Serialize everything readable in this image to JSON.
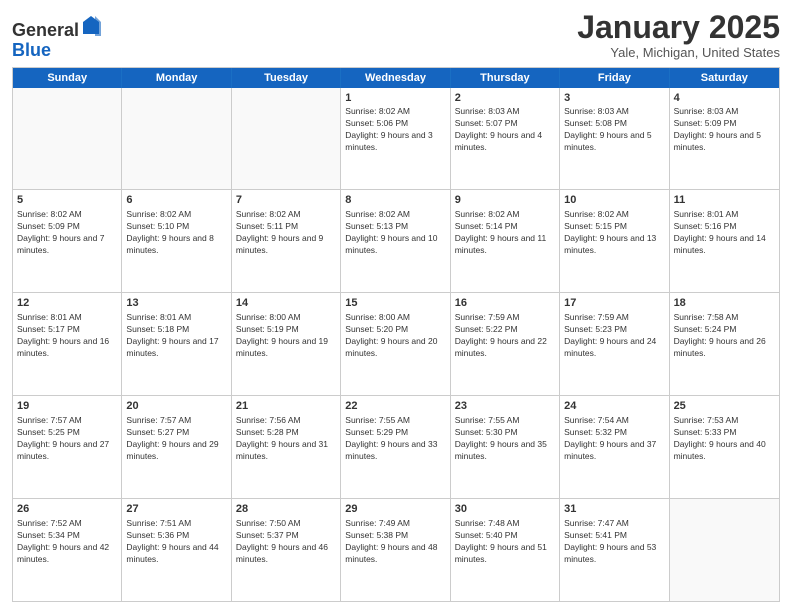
{
  "logo": {
    "general": "General",
    "blue": "Blue"
  },
  "title": "January 2025",
  "location": "Yale, Michigan, United States",
  "days_of_week": [
    "Sunday",
    "Monday",
    "Tuesday",
    "Wednesday",
    "Thursday",
    "Friday",
    "Saturday"
  ],
  "weeks": [
    [
      {
        "day": "",
        "info": ""
      },
      {
        "day": "",
        "info": ""
      },
      {
        "day": "",
        "info": ""
      },
      {
        "day": "1",
        "info": "Sunrise: 8:02 AM\nSunset: 5:06 PM\nDaylight: 9 hours and 3 minutes."
      },
      {
        "day": "2",
        "info": "Sunrise: 8:03 AM\nSunset: 5:07 PM\nDaylight: 9 hours and 4 minutes."
      },
      {
        "day": "3",
        "info": "Sunrise: 8:03 AM\nSunset: 5:08 PM\nDaylight: 9 hours and 5 minutes."
      },
      {
        "day": "4",
        "info": "Sunrise: 8:03 AM\nSunset: 5:09 PM\nDaylight: 9 hours and 5 minutes."
      }
    ],
    [
      {
        "day": "5",
        "info": "Sunrise: 8:02 AM\nSunset: 5:09 PM\nDaylight: 9 hours and 7 minutes."
      },
      {
        "day": "6",
        "info": "Sunrise: 8:02 AM\nSunset: 5:10 PM\nDaylight: 9 hours and 8 minutes."
      },
      {
        "day": "7",
        "info": "Sunrise: 8:02 AM\nSunset: 5:11 PM\nDaylight: 9 hours and 9 minutes."
      },
      {
        "day": "8",
        "info": "Sunrise: 8:02 AM\nSunset: 5:13 PM\nDaylight: 9 hours and 10 minutes."
      },
      {
        "day": "9",
        "info": "Sunrise: 8:02 AM\nSunset: 5:14 PM\nDaylight: 9 hours and 11 minutes."
      },
      {
        "day": "10",
        "info": "Sunrise: 8:02 AM\nSunset: 5:15 PM\nDaylight: 9 hours and 13 minutes."
      },
      {
        "day": "11",
        "info": "Sunrise: 8:01 AM\nSunset: 5:16 PM\nDaylight: 9 hours and 14 minutes."
      }
    ],
    [
      {
        "day": "12",
        "info": "Sunrise: 8:01 AM\nSunset: 5:17 PM\nDaylight: 9 hours and 16 minutes."
      },
      {
        "day": "13",
        "info": "Sunrise: 8:01 AM\nSunset: 5:18 PM\nDaylight: 9 hours and 17 minutes."
      },
      {
        "day": "14",
        "info": "Sunrise: 8:00 AM\nSunset: 5:19 PM\nDaylight: 9 hours and 19 minutes."
      },
      {
        "day": "15",
        "info": "Sunrise: 8:00 AM\nSunset: 5:20 PM\nDaylight: 9 hours and 20 minutes."
      },
      {
        "day": "16",
        "info": "Sunrise: 7:59 AM\nSunset: 5:22 PM\nDaylight: 9 hours and 22 minutes."
      },
      {
        "day": "17",
        "info": "Sunrise: 7:59 AM\nSunset: 5:23 PM\nDaylight: 9 hours and 24 minutes."
      },
      {
        "day": "18",
        "info": "Sunrise: 7:58 AM\nSunset: 5:24 PM\nDaylight: 9 hours and 26 minutes."
      }
    ],
    [
      {
        "day": "19",
        "info": "Sunrise: 7:57 AM\nSunset: 5:25 PM\nDaylight: 9 hours and 27 minutes."
      },
      {
        "day": "20",
        "info": "Sunrise: 7:57 AM\nSunset: 5:27 PM\nDaylight: 9 hours and 29 minutes."
      },
      {
        "day": "21",
        "info": "Sunrise: 7:56 AM\nSunset: 5:28 PM\nDaylight: 9 hours and 31 minutes."
      },
      {
        "day": "22",
        "info": "Sunrise: 7:55 AM\nSunset: 5:29 PM\nDaylight: 9 hours and 33 minutes."
      },
      {
        "day": "23",
        "info": "Sunrise: 7:55 AM\nSunset: 5:30 PM\nDaylight: 9 hours and 35 minutes."
      },
      {
        "day": "24",
        "info": "Sunrise: 7:54 AM\nSunset: 5:32 PM\nDaylight: 9 hours and 37 minutes."
      },
      {
        "day": "25",
        "info": "Sunrise: 7:53 AM\nSunset: 5:33 PM\nDaylight: 9 hours and 40 minutes."
      }
    ],
    [
      {
        "day": "26",
        "info": "Sunrise: 7:52 AM\nSunset: 5:34 PM\nDaylight: 9 hours and 42 minutes."
      },
      {
        "day": "27",
        "info": "Sunrise: 7:51 AM\nSunset: 5:36 PM\nDaylight: 9 hours and 44 minutes."
      },
      {
        "day": "28",
        "info": "Sunrise: 7:50 AM\nSunset: 5:37 PM\nDaylight: 9 hours and 46 minutes."
      },
      {
        "day": "29",
        "info": "Sunrise: 7:49 AM\nSunset: 5:38 PM\nDaylight: 9 hours and 48 minutes."
      },
      {
        "day": "30",
        "info": "Sunrise: 7:48 AM\nSunset: 5:40 PM\nDaylight: 9 hours and 51 minutes."
      },
      {
        "day": "31",
        "info": "Sunrise: 7:47 AM\nSunset: 5:41 PM\nDaylight: 9 hours and 53 minutes."
      },
      {
        "day": "",
        "info": ""
      }
    ]
  ]
}
